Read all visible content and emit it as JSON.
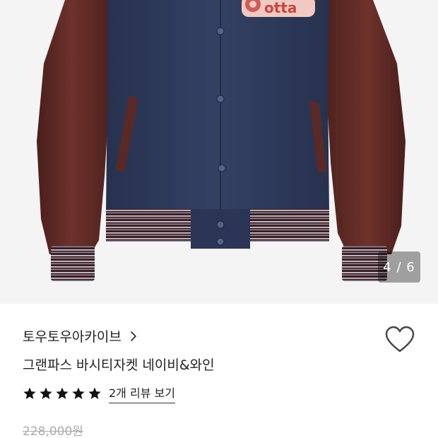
{
  "gallery": {
    "counter": "4 / 6",
    "patch_text": "otta"
  },
  "product": {
    "brand": "토우토우아카이브",
    "name": "그랜파스 바시티자켓 네이비&와인",
    "review_link": "2개 리뷰 보기",
    "rating": 5,
    "rating_max": 5,
    "original_price": "228,000원"
  },
  "icons": {
    "chevron": "chevron-right-icon",
    "wishlist": "heart-outline-icon",
    "star": "star-filled-icon"
  },
  "colors": {
    "body_navy": "#2e3a5c",
    "sleeve_wine": "#5f2b26",
    "star": "#111111",
    "price_gray": "#aaaaaa"
  }
}
